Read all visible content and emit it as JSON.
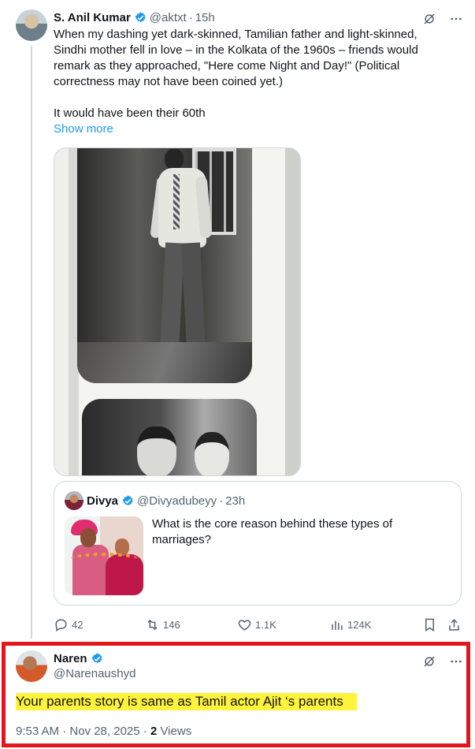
{
  "original_post": {
    "author_name": "S. Anil Kumar",
    "handle": "@aktxt",
    "age": "15h",
    "text_paragraph_1": "When my dashing yet dark-skinned, Tamilian father and light-skinned, Sindhi mother fell in love – in the Kolkata of the 1960s – friends would remark as they approached, \"Here come Night and Day!\" (Political correctness may not have been coined yet.)",
    "text_paragraph_2": "It would have been their 60th",
    "show_more": "Show more",
    "quoted_post": {
      "author_name": "Divya",
      "handle": "@Divyadubeyy",
      "age": "23h",
      "text": "What is the core reason behind these types of marriages?"
    },
    "metrics": {
      "replies": "42",
      "reposts": "146",
      "likes": "1.1K",
      "views": "124K"
    }
  },
  "reply": {
    "author_name": "Naren",
    "handle": "@Narenaushyd",
    "text": "Your parents story is same as Tamil actor Ajit ‘s parents",
    "timestamp": "9:53 AM · Nov 28, 2025 ·",
    "views_count": "2",
    "views_label": "Views"
  },
  "icons": {
    "verified": "verified-badge-icon",
    "grok": "grok-icon",
    "more": "more-icon",
    "reply": "reply-icon",
    "repost": "repost-icon",
    "like": "like-icon",
    "views": "views-icon",
    "bookmark": "bookmark-icon",
    "share": "share-icon"
  },
  "colors": {
    "text": "#0f1419",
    "muted": "#536471",
    "link": "#1d9bf0",
    "verified": "#1d9bf0",
    "highlight": "#fff33b",
    "outline": "#e4161d"
  }
}
